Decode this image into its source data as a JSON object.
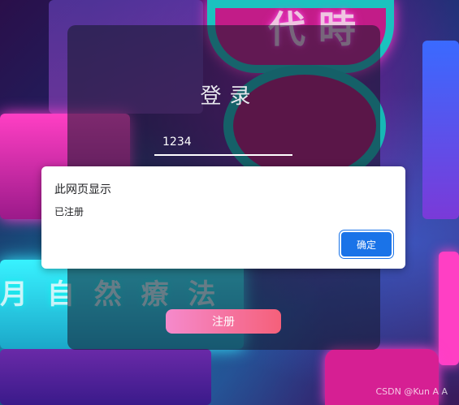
{
  "login_card": {
    "title": "登录",
    "username_value": "1234",
    "register_label": "注册"
  },
  "alert_dialog": {
    "title": "此网页显示",
    "message": "已注册",
    "ok_label": "确定"
  },
  "background": {
    "sign_text_1": "月 自 然 療 法",
    "sign_text_2": "代 時"
  },
  "watermark": "CSDN @Kun A A",
  "colors": {
    "accent_blue": "#1a73e8",
    "register_gradient_start": "#f58acc",
    "register_gradient_end": "#f5607a"
  }
}
